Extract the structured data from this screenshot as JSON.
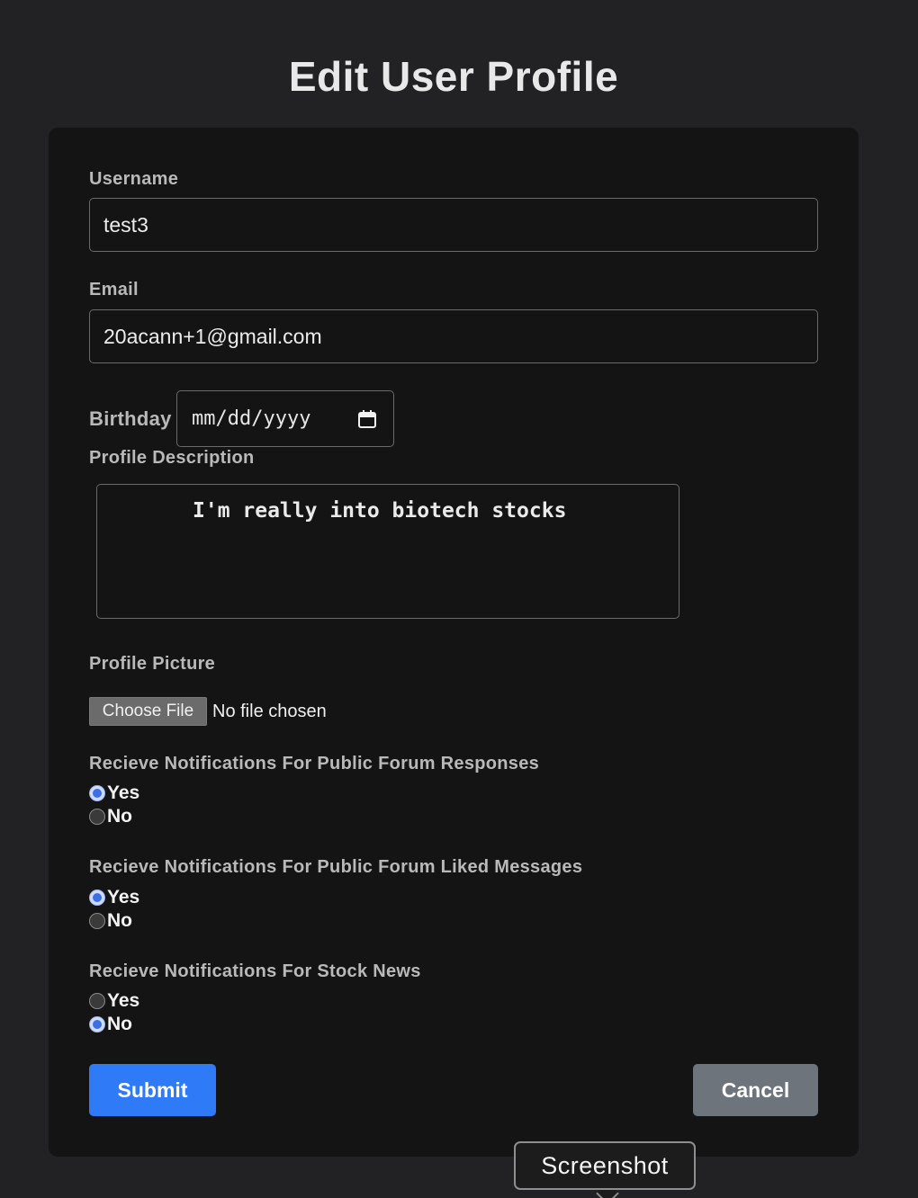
{
  "page": {
    "title": "Edit User Profile"
  },
  "form": {
    "username": {
      "label": "Username",
      "value": "test3"
    },
    "email": {
      "label": "Email",
      "value": "20acann+1@gmail.com"
    },
    "birthday": {
      "label": "Birthday",
      "placeholder": "mm/dd/yyyy",
      "icon": "calendar-icon"
    },
    "description": {
      "label": "Profile Description",
      "value": "I'm really into biotech stocks"
    },
    "picture": {
      "label": "Profile Picture",
      "button_label": "Choose File",
      "status": "No file chosen"
    },
    "notifications": [
      {
        "label": "Recieve Notifications For Public Forum Responses",
        "yes": "Yes",
        "no": "No",
        "selected": "Yes"
      },
      {
        "label": "Recieve Notifications For Public Forum Liked Messages",
        "yes": "Yes",
        "no": "No",
        "selected": "Yes"
      },
      {
        "label": "Recieve Notifications For Stock News",
        "yes": "Yes",
        "no": "No",
        "selected": "No"
      }
    ],
    "submit_label": "Submit",
    "cancel_label": "Cancel"
  },
  "tooltip": {
    "text": "Screenshot"
  },
  "colors": {
    "background": "#222225",
    "card": "#141414",
    "submit": "#2f7af6",
    "cancel": "#6d747c",
    "radio_checked": "#3c6fe6"
  }
}
